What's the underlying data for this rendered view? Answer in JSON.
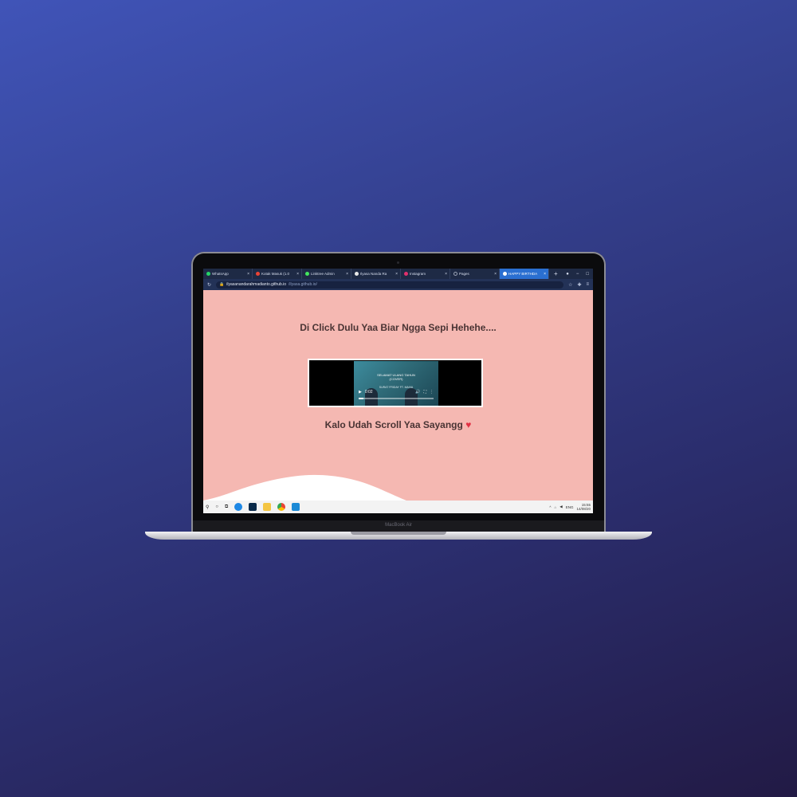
{
  "device_label": "MacBook Air",
  "browser": {
    "tabs": [
      {
        "label": "WhatsApp",
        "fav_color": "#25d366",
        "active": false
      },
      {
        "label": "Kotak Masuk (1.0",
        "fav_color": "#ea4335",
        "active": false
      },
      {
        "label": "Linktree Admin",
        "fav_color": "#43e55e",
        "active": false
      },
      {
        "label": "Ilyasa Nanda Ra",
        "fav_color": "#e8e8e8",
        "active": false
      },
      {
        "label": "Instagram",
        "fav_color": "#e1306c",
        "active": false
      },
      {
        "label": "Pages",
        "fav_color": "#9aa3b5",
        "active": false
      },
      {
        "label": "HAPPY BIRTHDA",
        "fav_color": "#ffffff",
        "active": true
      }
    ],
    "new_tab": "+",
    "url_host": "ilyasanandarahmadianto.github.io",
    "url_path": "/ilyasa.github.io/"
  },
  "page": {
    "heading": "Di Click Dulu Yaa Biar Ngga Sepi Hehehe....",
    "video": {
      "title_line1": "SELAMAT ULANG TAHUN",
      "title_line2": "(COVER)",
      "subtitle": "SURAT FRIDAY FT. MAIVA",
      "time": "0:02",
      "progress": 0.06
    },
    "caption": "Kalo Udah Scroll Yaa Sayangg",
    "heart": "♥"
  },
  "taskbar": {
    "language": "ENG",
    "time": "15:55",
    "date": "14/08/20"
  }
}
